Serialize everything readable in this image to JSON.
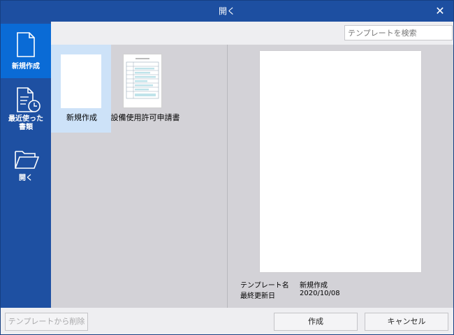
{
  "window": {
    "title": "開く",
    "close_symbol": "✕"
  },
  "sidebar": {
    "items": [
      {
        "label_line1": "新規作成",
        "label_line2": "",
        "icon": "new-document-icon",
        "active": true
      },
      {
        "label_line1": "最近使った",
        "label_line2": "書類",
        "icon": "recent-documents-icon",
        "active": false
      },
      {
        "label_line1": "開く",
        "label_line2": "",
        "icon": "folder-open-icon",
        "active": false
      }
    ]
  },
  "search": {
    "placeholder": "テンプレートを検索"
  },
  "templates": [
    {
      "label": "新規作成",
      "selected": true
    },
    {
      "label": "設備使用許可申請書",
      "selected": false
    }
  ],
  "preview": {
    "name_key": "テンプレート名",
    "name_value": "新規作成",
    "updated_key": "最終更新日",
    "updated_value": "2020/10/08"
  },
  "buttons": {
    "delete_label": "テンプレートから削除",
    "create_label": "作成",
    "cancel_label": "キャンセル"
  },
  "colors": {
    "sidebar": "#1e50a2",
    "sidebar_active": "#0a6bd6",
    "content_bg": "#d3d2d7",
    "selected_tile": "#cde2f8"
  }
}
